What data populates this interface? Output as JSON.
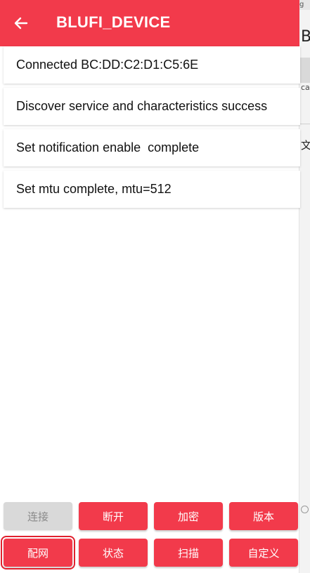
{
  "toolbar": {
    "title": "BLUFI_DEVICE",
    "back_icon": "arrow-left-icon",
    "color": "#f23a4b"
  },
  "logs": [
    "Connected BC:DD:C2:D1:C5:6E",
    "Discover service and characteristics success",
    "Set notification enable  complete",
    "Set mtu complete, mtu=512"
  ],
  "buttons": {
    "row1": [
      "连接",
      "断开",
      "加密",
      "版本"
    ],
    "row2": [
      "配网",
      "状态",
      "扫描",
      "自定义"
    ]
  },
  "background_app": {
    "top": "g",
    "letter": "B",
    "small": "ca",
    "char": "文"
  }
}
